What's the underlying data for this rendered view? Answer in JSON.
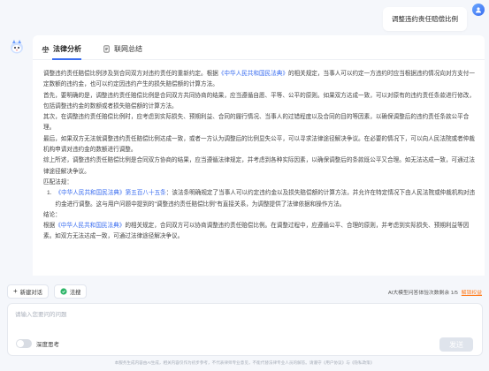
{
  "user": {
    "question": "调整违约责任赔偿比例"
  },
  "tabs": [
    {
      "label": "法律分析",
      "icon": "scale-icon",
      "active": true
    },
    {
      "label": "联网总结",
      "icon": "document-icon",
      "active": false
    }
  ],
  "analysis": {
    "p1a": "调整违约责任赔偿比例涉及到合同双方对违约责任的重新约定。根据",
    "p1_law": "《中华人民共和国民法典》",
    "p1b": "的相关规定，当事人可以约定一方违约时应当根据违约情况向对方支付一定数额的违约金，也可以约定因违约产生的损失赔偿额的计算方法。",
    "p2": "首先，要明确的是，调整违约责任赔偿比例是合同双方共同协商的结果，应当遵循自愿、平等、公平的原则。如果双方达成一致，可以对原有的违约责任条款进行修改，包括调整违约金的数额或者损失赔偿额的计算方法。",
    "p3": "其次，在调整违约责任赔偿比例时，应考虑到实际损失、预期利益、合同的履行情况、当事人的过错程度以及合同的目的等因素，以确保调整后的违约责任条款公平合理。",
    "p4": "最后，如果双方无法就调整违约责任赔偿比例达成一致，或者一方认为调整后的比例显失公平，可以寻求法律途径解决争议。在必要的情况下，可以向人民法院或者仲裁机构申请对违约金的数额进行调整。",
    "p5": "综上所述，调整违约责任赔偿比例是合同双方协商的结果，应当遵循法律规定，并考虑到各种实际因素，以确保调整后的条款既公平又合理。如无法达成一致，可通过法律途径解决争议。",
    "basis_label": "匹配法规：",
    "law_num": "1.",
    "law_link": "《中华人民共和国民法典》第五百八十五条",
    "law_text": "：该法条明确规定了当事人可以约定违约金以及损失赔偿额的计算方法，并允许在特定情况下由人民法院或仲裁机构对违约金进行调整。这与用户问题中提到的\"调整违约责任赔偿比例\"有直接关系，为调整提供了法律依据和操作方法。",
    "conclusion_label": "结论：",
    "c1": "根据",
    "c_law": "《中华人民共和国民法典》",
    "c2": "的相关规定，合同双方可以协商调整违约责任赔偿比例。在调整过程中，应遵循公平、合理的原则，并考虑到实际损失、预期利益等因素。如双方无法达成一致，可通过法律途径解决争议。"
  },
  "toolbar": {
    "new_chat": "新建对话",
    "recommend": "法搜",
    "quota_text": "AI大模型问答体验次数剩余 1/5",
    "quota_link": "解锁权益"
  },
  "input": {
    "placeholder": "请输入您要问的问题",
    "deep_think": "深度思考",
    "send": "发送"
  },
  "footer": {
    "text": "本服务生成内容由AI生成，相关内容仅作为初步参考，不代表律师专业意见，不能代替法律专业人员的解答。请遵守《用户协议》与《隐私政策》",
    "link1": "《用户协议》",
    "link2": "《隐私政策》"
  },
  "colors": {
    "accent": "#3a6df0",
    "orange": "#ff7a1a",
    "bg": "#f5f7fb"
  }
}
